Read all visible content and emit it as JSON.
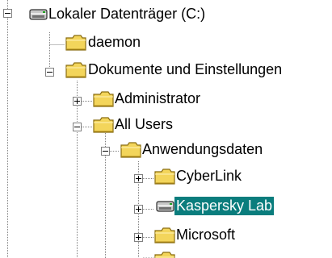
{
  "colors": {
    "selection_bg": "#0a7d7d",
    "selection_fg": "#ffffff",
    "folder_fill": "#f3d55b",
    "tree_line": "#808080"
  },
  "tree": {
    "nodes": [
      {
        "label": "Lokaler Datenträger (C:)",
        "icon": "drive-icon",
        "toggle": "expanded",
        "selected": false
      },
      {
        "label": "daemon",
        "icon": "folder-icon",
        "toggle": "none",
        "selected": false
      },
      {
        "label": "Dokumente und Einstellungen",
        "icon": "folder-icon",
        "toggle": "expanded",
        "selected": false
      },
      {
        "label": "Administrator",
        "icon": "folder-icon",
        "toggle": "collapsed",
        "selected": false
      },
      {
        "label": "All Users",
        "icon": "folder-icon",
        "toggle": "expanded",
        "selected": false
      },
      {
        "label": "Anwendungsdaten",
        "icon": "folder-icon",
        "toggle": "expanded",
        "selected": false
      },
      {
        "label": "CyberLink",
        "icon": "folder-icon",
        "toggle": "collapsed",
        "selected": false
      },
      {
        "label": "Kaspersky Lab",
        "icon": "drive-icon",
        "toggle": "collapsed",
        "selected": true
      },
      {
        "label": "Microsoft",
        "icon": "folder-icon",
        "toggle": "collapsed",
        "selected": false
      },
      {
        "label": "",
        "icon": "folder-icon",
        "toggle": "none",
        "selected": false
      }
    ]
  }
}
